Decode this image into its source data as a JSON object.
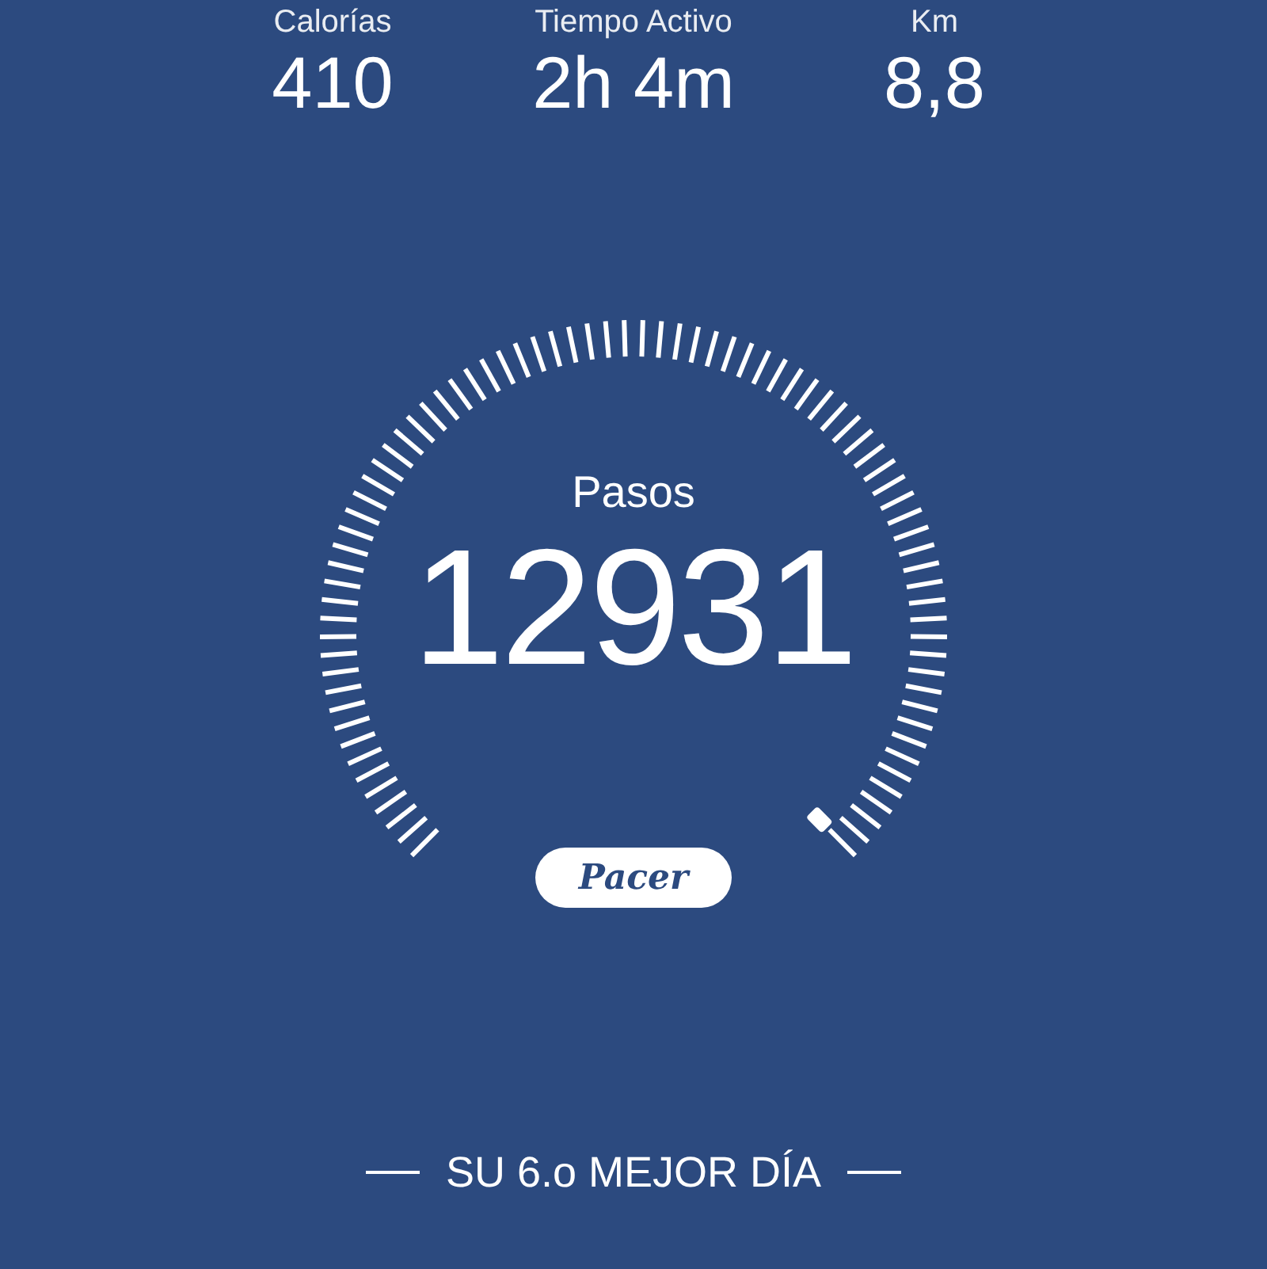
{
  "stats": [
    {
      "label": "Calorías",
      "value": "410"
    },
    {
      "label": "Tiempo Activo",
      "value": "2h 4m"
    },
    {
      "label": "Km",
      "value": "8,8"
    }
  ],
  "gauge": {
    "label": "Pasos",
    "value": "12931"
  },
  "logo": "Pacer",
  "rank": "SU 6.o MEJOR DÍA"
}
